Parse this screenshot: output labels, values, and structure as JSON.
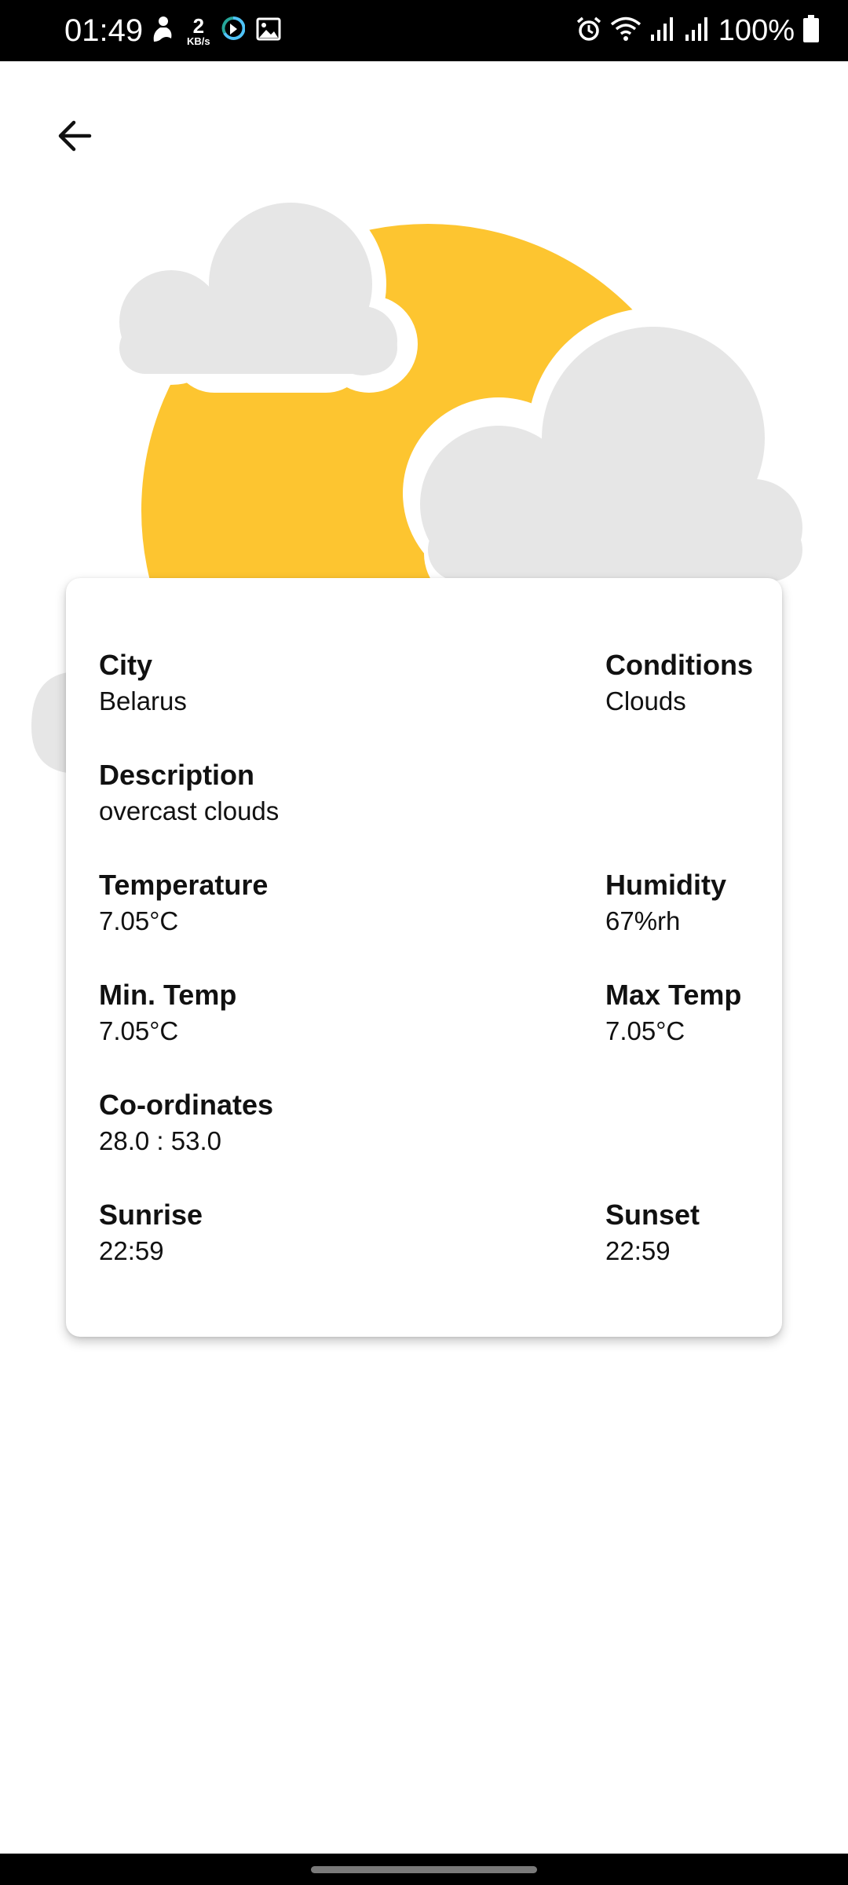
{
  "status_bar": {
    "time": "01:49",
    "net_speed_value": "2",
    "net_speed_unit": "KB/s",
    "battery_percent": "100%",
    "icons": [
      "notification-app-icon",
      "data-speed-icon",
      "sync-app-icon",
      "gallery-icon",
      "alarm-icon",
      "wifi-icon",
      "signal-icon",
      "signal-icon",
      "battery-icon"
    ]
  },
  "colors": {
    "sun": "#FDC530",
    "cloud": "#E6E6E6",
    "status_bar": "#000000",
    "text": "#111111"
  },
  "header": {
    "back_icon": "arrow-back-icon"
  },
  "illustration": {
    "icon": "sun-behind-clouds-icon"
  },
  "weather": {
    "city_label": "City",
    "city_value": "Belarus",
    "conditions_label": "Conditions",
    "conditions_value": "Clouds",
    "description_label": "Description",
    "description_value": "overcast clouds",
    "temperature_label": "Temperature",
    "temperature_value": "7.05°C",
    "humidity_label": "Humidity",
    "humidity_value": "67%rh",
    "min_temp_label": "Min. Temp",
    "min_temp_value": "7.05°C",
    "max_temp_label": "Max Temp",
    "max_temp_value": "7.05°C",
    "coordinates_label": "Co-ordinates",
    "coordinates_value": "28.0 : 53.0",
    "sunrise_label": "Sunrise",
    "sunrise_value": "22:59",
    "sunset_label": "Sunset",
    "sunset_value": "22:59"
  }
}
